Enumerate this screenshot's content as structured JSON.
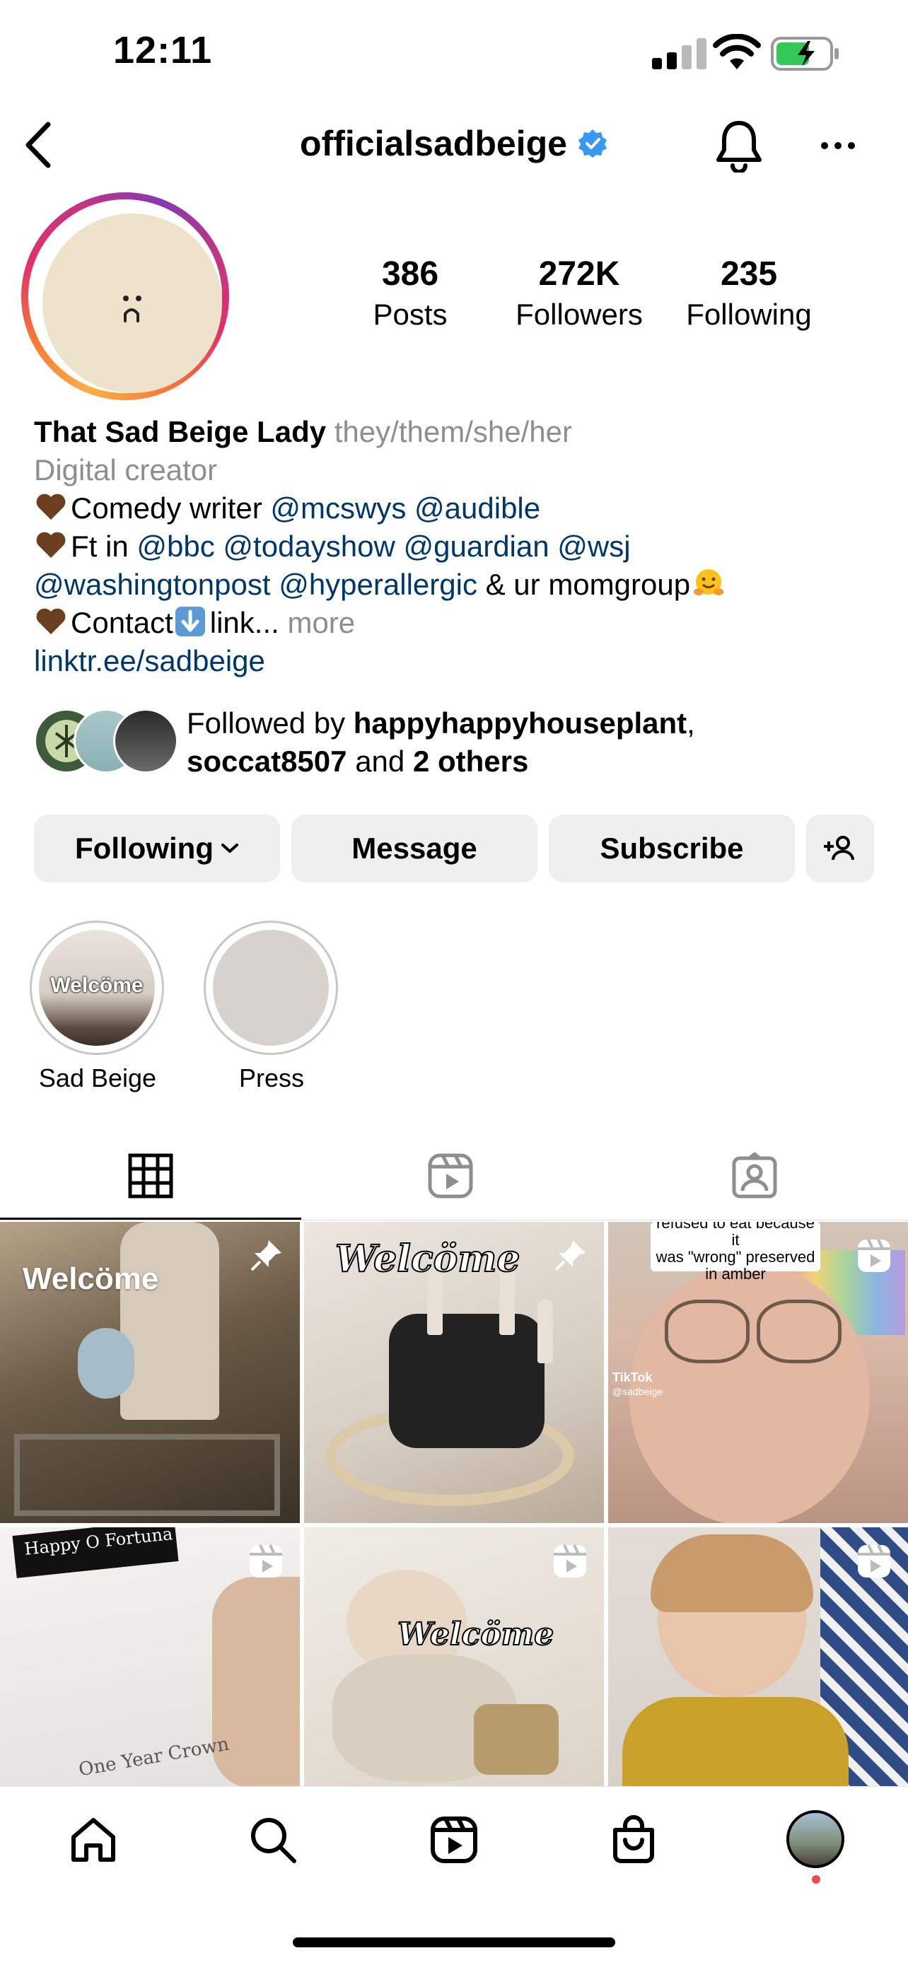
{
  "status_bar": {
    "time": "12:11"
  },
  "header": {
    "username": "officialsadbeige"
  },
  "stats": [
    {
      "value": "386",
      "label": "Posts"
    },
    {
      "value": "272K",
      "label": "Followers"
    },
    {
      "value": "235",
      "label": "Following"
    }
  ],
  "bio": {
    "name": "That Sad Beige Lady",
    "pronouns": "they/them/she/her",
    "category": "Digital creator",
    "line1_text": "Comedy writer",
    "line1_mentions": [
      "@mcswys",
      "@audible"
    ],
    "line2_text": "Ft in",
    "line2_mentions": [
      "@bbc",
      "@todayshow",
      "@guardian",
      "@wsj"
    ],
    "line3_mentions": [
      "@washingtonpost",
      "@hyperallergic"
    ],
    "line3_text": "& ur momgroup",
    "line4_text_a": "Contact",
    "line4_text_b": "link...",
    "more": "more",
    "link": "linktr.ee/sadbeige"
  },
  "followed_by": {
    "prefix": "Followed by",
    "user1": "happyhappyhouseplant",
    "comma": ",",
    "user2": "soccat8507",
    "and": "and",
    "others": "2 others"
  },
  "buttons": {
    "following": "Following",
    "message": "Message",
    "subscribe": "Subscribe"
  },
  "highlights": [
    {
      "label": "Sad Beige",
      "cover_text": "Welcöme"
    },
    {
      "label": "Press"
    }
  ],
  "grid": {
    "tile1_caption": "Welcöme",
    "tile2_caption": "Welcöme",
    "tile3_caption_a": "refused to eat because it",
    "tile3_caption_b": "was \"wrong\" preserved",
    "tile3_caption_c": "in amber",
    "tile3_watermark": "TikTok",
    "tile3_handle": "@sadbeige",
    "tile4_banner": "Happy O Fortuna",
    "tile4_text": "One Year Crown",
    "tile5_caption": "Welcöme"
  },
  "colors": {
    "link": "#00376b",
    "secondary_text": "#8e8e8e",
    "button_bg": "#efefef",
    "verified": "#3897f0",
    "notification_dot": "#ed4956",
    "battery_green": "#34c759"
  },
  "icons": [
    "back-icon",
    "verified-icon",
    "bell-icon",
    "more-icon",
    "grid-icon",
    "reels-icon",
    "tagged-icon",
    "pin-icon",
    "reel-badge-icon",
    "home-icon",
    "search-icon",
    "shop-icon",
    "add-person-icon",
    "chevron-down-icon"
  ]
}
